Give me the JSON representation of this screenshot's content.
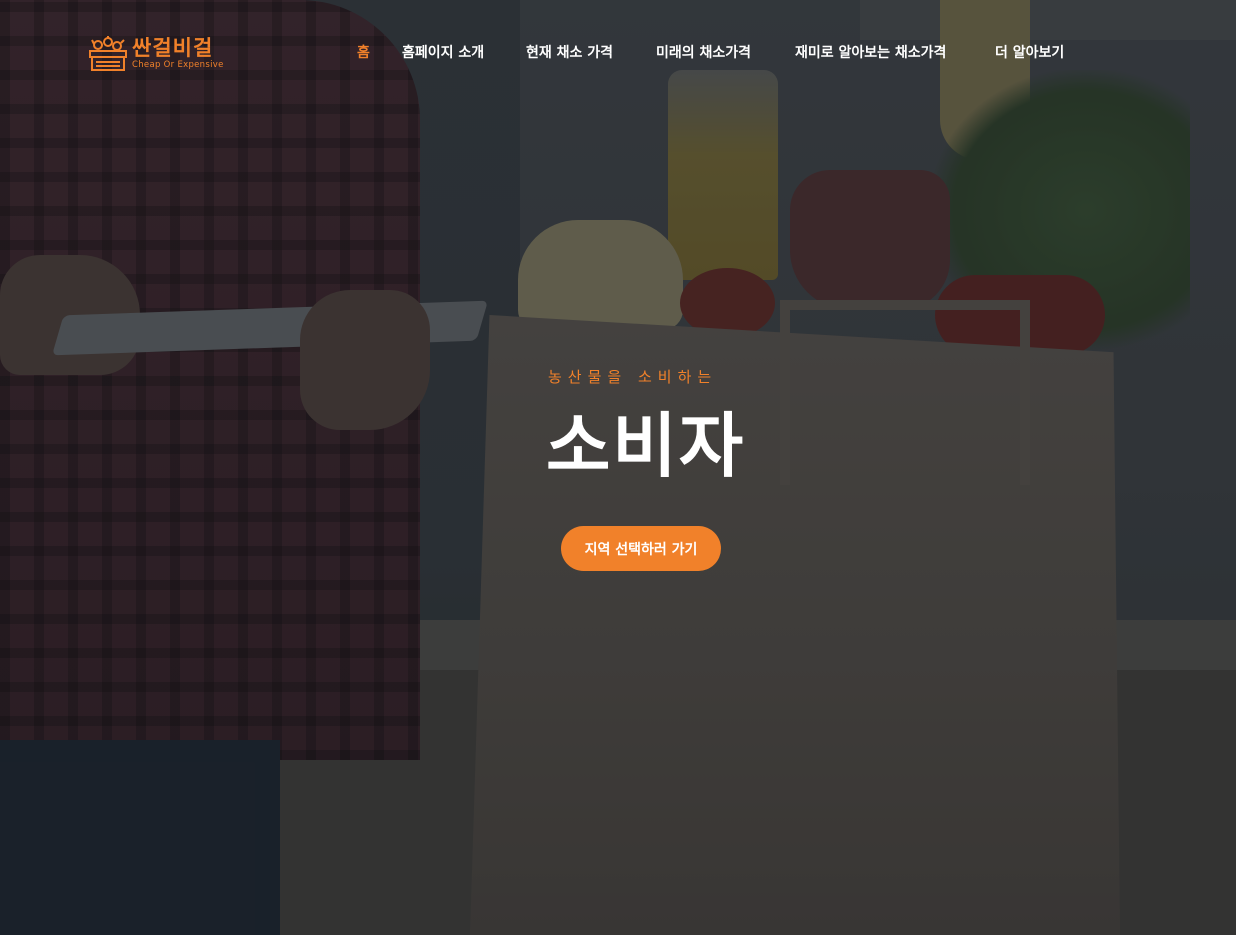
{
  "brand": {
    "name": "싼걸비걸",
    "tagline": "Cheap Or Expensive",
    "accent_color": "#f1812a",
    "icon": "vegetable-crate-icon"
  },
  "nav": {
    "items": [
      {
        "label": "홈",
        "active": true
      },
      {
        "label": "홈페이지 소개",
        "active": false
      },
      {
        "label": "현재 채소 가격",
        "active": false
      },
      {
        "label": "미래의 채소가격",
        "active": false
      },
      {
        "label": "재미로 알아보는 채소가격",
        "active": false
      },
      {
        "label": "더 알아보기",
        "active": false
      }
    ]
  },
  "hero": {
    "eyebrow": "농산물을 소비하는",
    "title": "소비자",
    "cta_label": "지역 선택하러 가기",
    "background": "grocery-bag-photo"
  }
}
